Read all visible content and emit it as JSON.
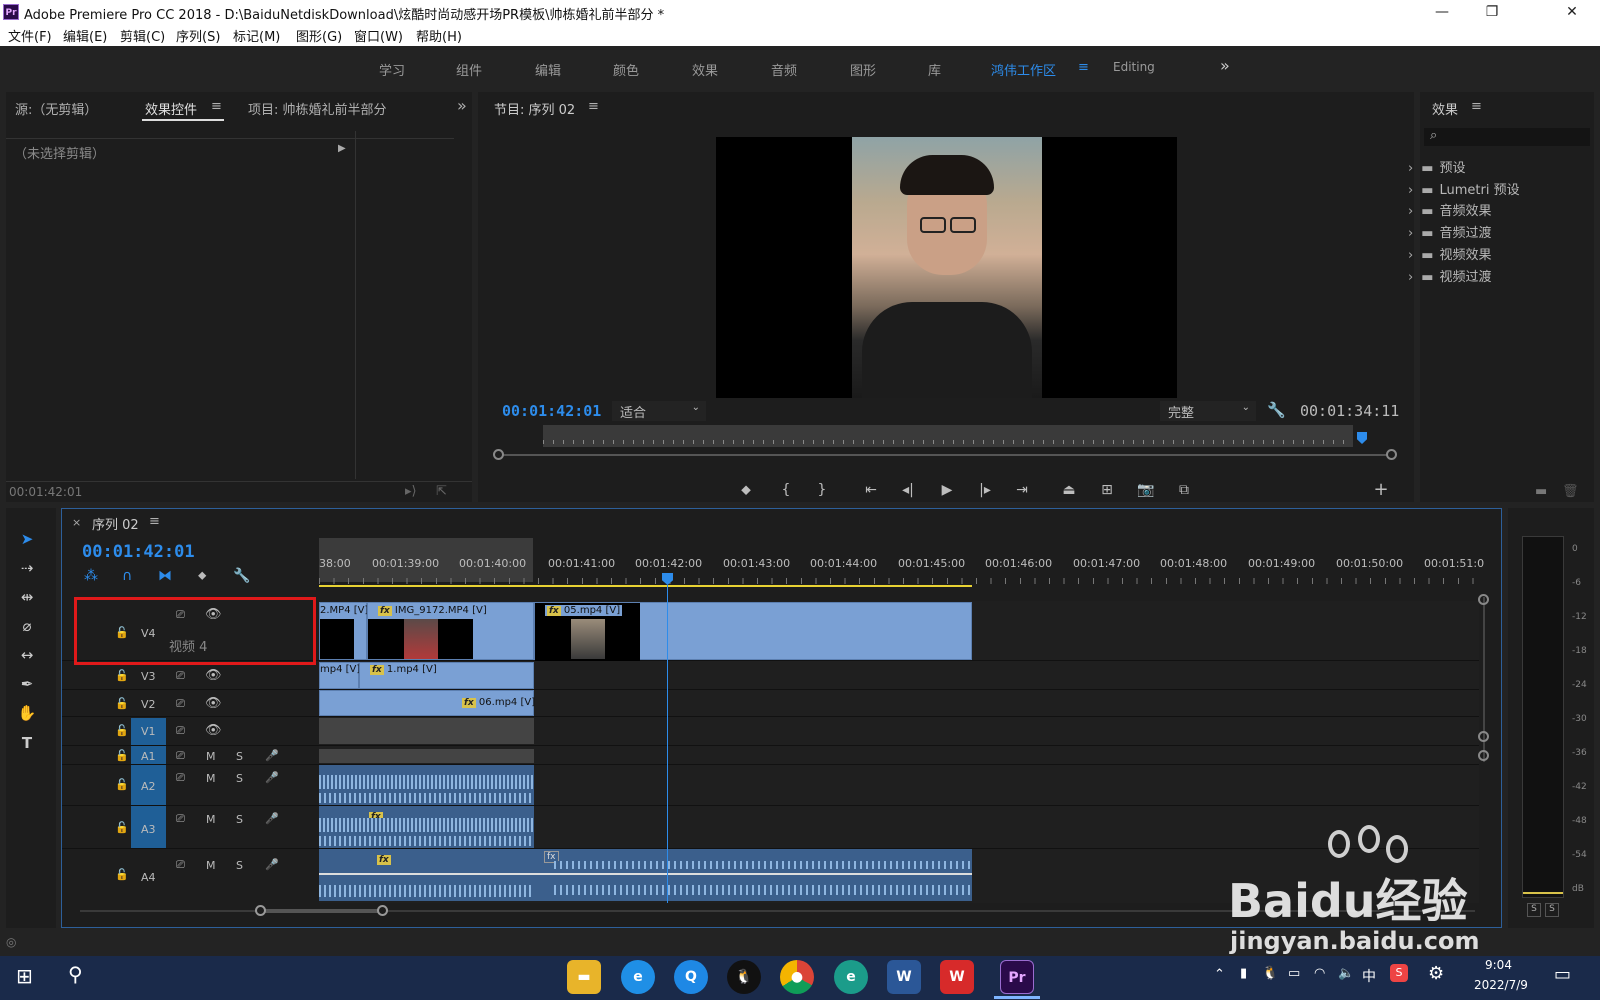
{
  "window": {
    "app_badge": "Pr",
    "title": "Adobe Premiere Pro CC 2018 - D:\\BaiduNetdiskDownload\\炫酷时尚动感开场PR模板\\帅栋婚礼前半部分 *",
    "minimize": "—",
    "restore": "❐",
    "close": "✕"
  },
  "menu": [
    "文件(F)",
    "编辑(E)",
    "剪辑(C)",
    "序列(S)",
    "标记(M)",
    "图形(G)",
    "窗口(W)",
    "帮助(H)"
  ],
  "workspaces": {
    "items": [
      "学习",
      "组件",
      "编辑",
      "颜色",
      "效果",
      "音频",
      "图形",
      "库"
    ],
    "active": "鸿伟工作区",
    "editing": "Editing",
    "overflow": "»"
  },
  "source_panel": {
    "tab_source": "源:（无剪辑）",
    "tab_effects_controls": "效果控件",
    "tab_project": "项目: 帅栋婚礼前半部分",
    "no_clip": "（未选择剪辑）",
    "timecode": "00:01:42:01"
  },
  "program_monitor": {
    "title": "节目: 序列 02",
    "timecode_left": "00:01:42:01",
    "fit": "适合",
    "quality": "完整",
    "timecode_right": "00:01:34:11"
  },
  "effects_panel": {
    "title": "效果",
    "items": [
      "预设",
      "Lumetri 预设",
      "音频效果",
      "音频过渡",
      "视频效果",
      "视频过渡"
    ]
  },
  "timeline": {
    "sequence_tab": "序列 02",
    "timecode": "00:01:42:01",
    "ruler": [
      "38:00",
      "00:01:39:00",
      "00:01:40:00",
      "00:01:41:00",
      "00:01:42:00",
      "00:01:43:00",
      "00:01:44:00",
      "00:01:45:00",
      "00:01:46:00",
      "00:01:47:00",
      "00:01:48:00",
      "00:01:49:00",
      "00:01:50:00",
      "00:01:51:0"
    ],
    "tracks": {
      "v4": "V4",
      "v4_name": "视频 4",
      "v3": "V3",
      "v2": "V2",
      "v1": "V1",
      "a1": "A1",
      "a2": "A2",
      "a3": "A3",
      "a4": "A4"
    },
    "m": "M",
    "s": "S",
    "clips": {
      "v4_a": "2.MP4 [V]",
      "v4_b": "IMG_9172.MP4 [V]",
      "v4_c": "05.mp4 [V]",
      "v3_a": "mp4 [V]",
      "v3_b": "1.mp4 [V]",
      "v2_a": "06.mp4 [V]"
    },
    "fx": "fx"
  },
  "meter": {
    "scale": [
      "0",
      "-6",
      "-12",
      "-18",
      "-24",
      "-30",
      "-36",
      "-42",
      "-48",
      "-54",
      "dB"
    ],
    "solo": [
      "S",
      "S"
    ]
  },
  "watermark": {
    "brand": "Baidu经验",
    "url": "jingyan.baidu.com"
  },
  "taskbar": {
    "time": "9:04",
    "date": "2022/7/9",
    "ime": "中"
  }
}
